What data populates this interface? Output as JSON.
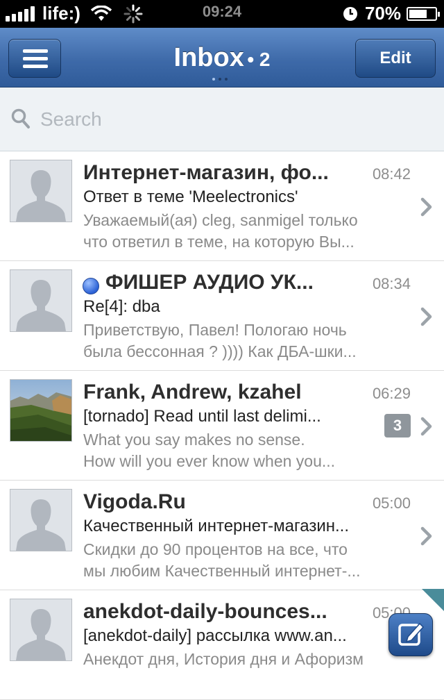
{
  "status_bar": {
    "carrier": "life:)",
    "time": "09:24",
    "battery": "70%",
    "battery_level": 0.7
  },
  "nav": {
    "title": "Inbox",
    "count": "• 2",
    "edit_label": "Edit"
  },
  "search": {
    "placeholder": "Search"
  },
  "messages": [
    {
      "sender": "Интернет-магазин, фо...",
      "time": "08:42",
      "subject": "Ответ в теме 'Meelectronics'",
      "preview1": "Уважаемый(ая) cleg, sanmigel только",
      "preview2": "что ответил в теме, на которую Вы...",
      "unread": false
    },
    {
      "sender": "ФИШЕР АУДИО  УК...",
      "time": "08:34",
      "subject": "Re[4]: dba",
      "preview1": "Приветствую, Павел! Пологаю ночь",
      "preview2": "была бессонная ? )))) Как ДБА-шки...",
      "unread": true
    },
    {
      "sender": "Frank, Andrew, kzahel",
      "time": "06:29",
      "subject": "[tornado] Read until last delimi...",
      "preview1": "What you say makes no sense.",
      "preview2": "How will you ever know when you...",
      "count": "3"
    },
    {
      "sender": "Vigoda.Ru",
      "time": "05:00",
      "subject": "Качественный интернет-магазин...",
      "preview1": "Скидки до 90 процентов на все, что",
      "preview2": "мы любим Качественный интернет-...",
      "unread": false
    },
    {
      "sender": "anekdot-daily-bounces...",
      "time": "05:00",
      "subject": "[anekdot-daily] рассылка www.an...",
      "preview1": "Анекдот дня, История дня и Афоризм",
      "preview2": "",
      "unread": false
    }
  ]
}
